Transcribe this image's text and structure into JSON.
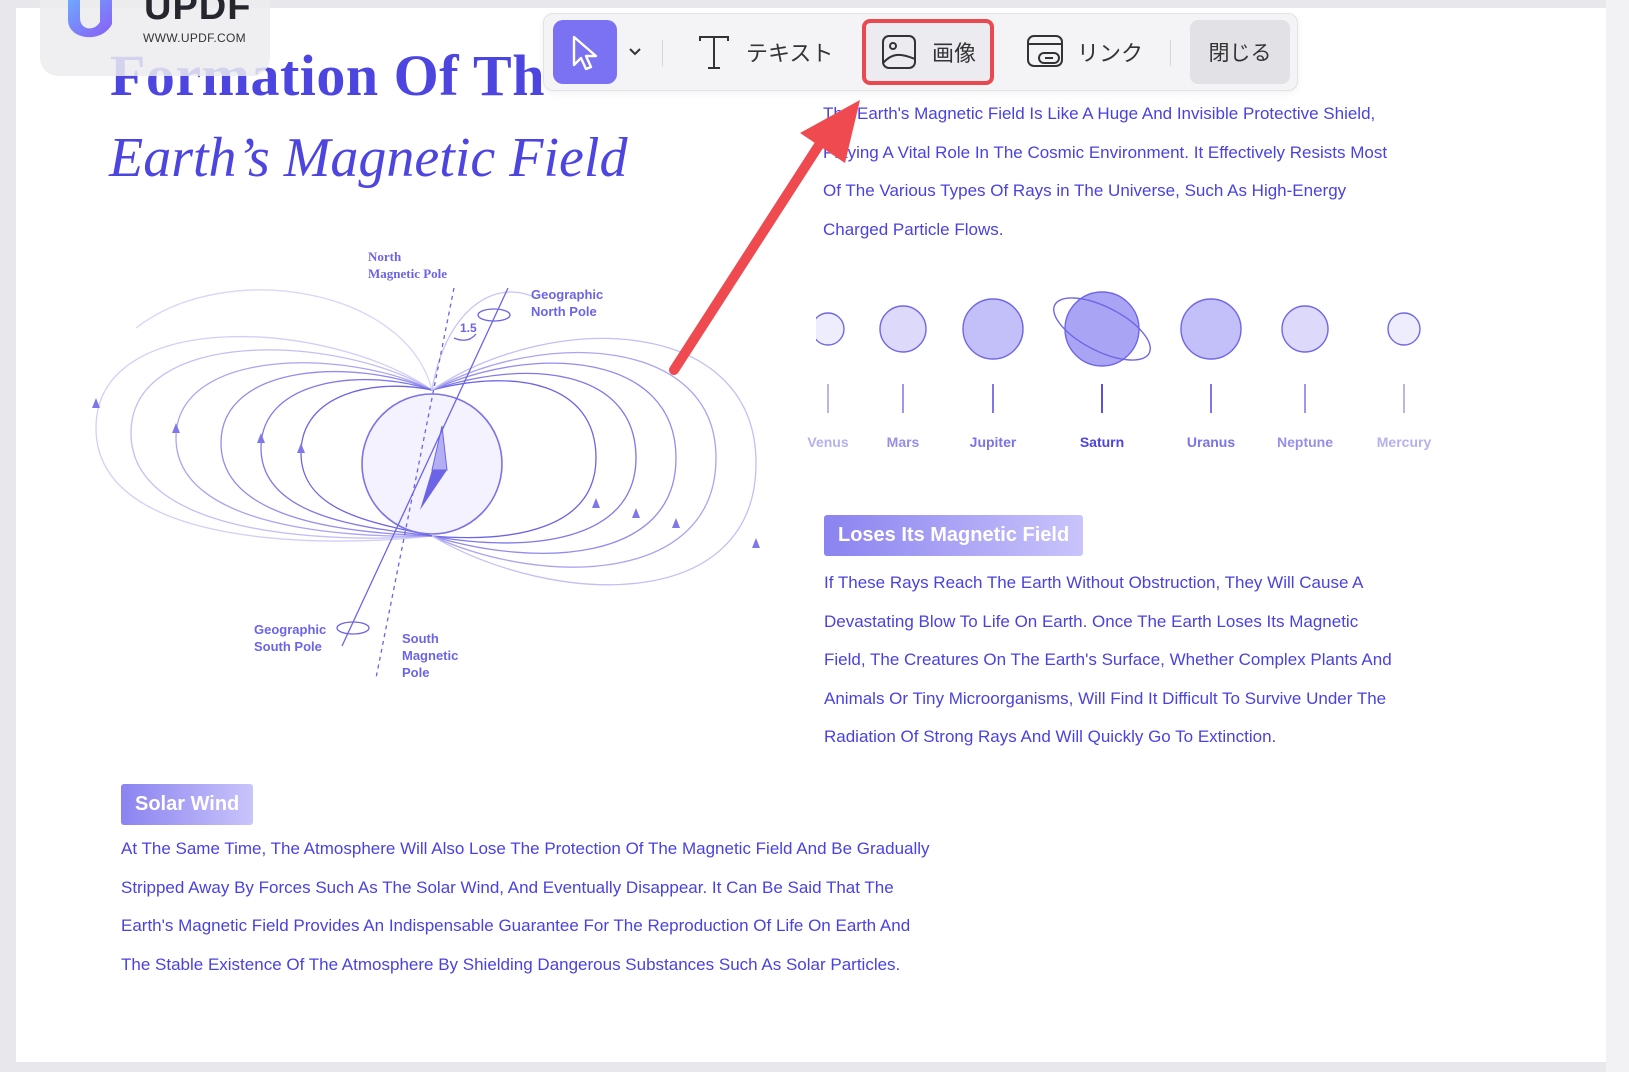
{
  "colors": {
    "accent": "#4d45e0",
    "tool_selected": "#7a72f2",
    "highlight_box": "#ea4a4f",
    "arrow": "#ee4a4f"
  },
  "watermark": {
    "brand": "UPDF",
    "url": "WWW.UPDF.COM"
  },
  "toolbar": {
    "select_icon": "cursor-arrow-icon",
    "text_label": "テキスト",
    "image_label": "画像",
    "link_label": "リンク",
    "close_label": "閉じる"
  },
  "document": {
    "title": "Formation Of Th",
    "subtitle": "Earth’s Magnetic Field",
    "intro_lines": [
      "The Earth's Magnetic Field Is Like A Huge And Invisible Protective Shield,",
      "Playing A Vital Role In The Cosmic Environment. It Effectively Resists Most",
      "Of The Various Types Of Rays in The Universe, Such As High-Energy",
      "Charged Particle Flows."
    ],
    "planets": [
      "Venus",
      "Mars",
      "Jupiter",
      "Saturn",
      "Uranus",
      "Neptune",
      "Mercury"
    ],
    "diagram": {
      "north_magnetic_pole": [
        "North",
        "Magnetic Pole"
      ],
      "geographic_north_pole": [
        "Geographic",
        "North Pole"
      ],
      "geographic_south_pole": [
        "Geographic",
        "South Pole"
      ],
      "south_magnetic_pole": [
        "South",
        "Magnetic",
        "Pole"
      ],
      "tilt_angle": "1.5"
    },
    "section_loses": {
      "heading": "Loses Its Magnetic Field",
      "lines": [
        "If These Rays Reach The Earth Without Obstruction, They Will Cause A",
        "Devastating Blow To Life On Earth. Once The Earth Loses Its Magnetic",
        "Field, The Creatures On The Earth's Surface, Whether Complex Plants And",
        "Animals Or Tiny Microorganisms, Will Find It Difficult To Survive Under The",
        "Radiation Of Strong Rays And Will Quickly Go To Extinction."
      ]
    },
    "section_solar": {
      "heading": "Solar Wind",
      "lines": [
        "At The Same Time, The Atmosphere Will Also Lose The Protection Of The Magnetic Field And Be Gradually",
        "Stripped Away By Forces Such As The Solar Wind, And Eventually Disappear. It Can Be Said That The",
        "Earth's Magnetic Field Provides An Indispensable Guarantee For The Reproduction Of Life On Earth And",
        "The Stable Existence Of The Atmosphere By Shielding Dangerous Substances Such As Solar Particles."
      ]
    }
  }
}
